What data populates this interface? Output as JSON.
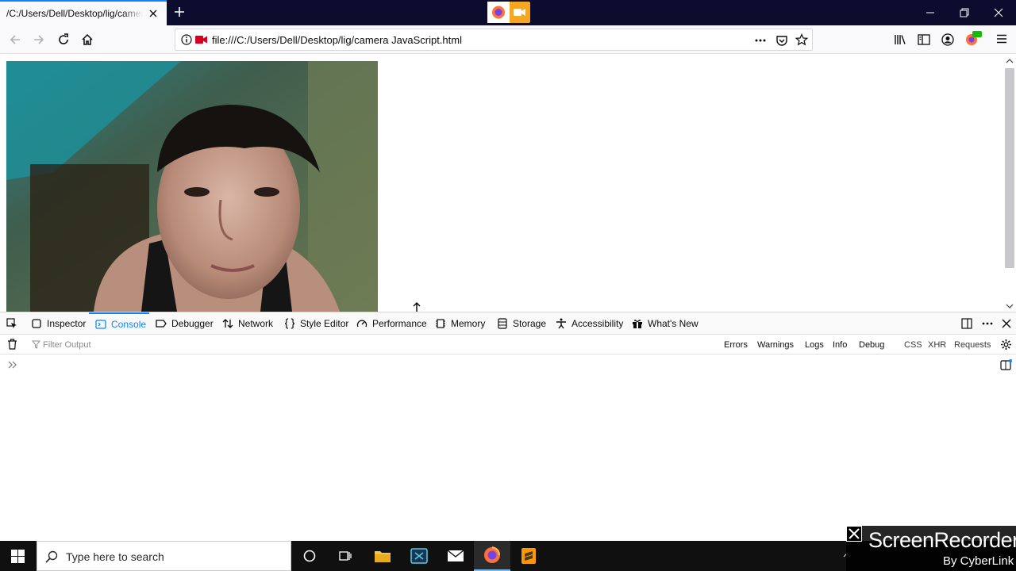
{
  "browser": {
    "tab": {
      "title": "/C:/Users/Dell/Desktop/lig/camera JavaScript.html"
    },
    "url": "file:///C:/Users/Dell/Desktop/lig/camera JavaScript.html",
    "accent": "#0a84ff"
  },
  "devtools": {
    "tabs": [
      {
        "label": "Inspector",
        "icon": "inspector-icon"
      },
      {
        "label": "Console",
        "icon": "console-icon",
        "selected": true
      },
      {
        "label": "Debugger",
        "icon": "debugger-icon"
      },
      {
        "label": "Network",
        "icon": "network-icon"
      },
      {
        "label": "Style Editor",
        "icon": "style-editor-icon"
      },
      {
        "label": "Performance",
        "icon": "performance-icon"
      },
      {
        "label": "Memory",
        "icon": "memory-icon"
      },
      {
        "label": "Storage",
        "icon": "storage-icon"
      },
      {
        "label": "Accessibility",
        "icon": "accessibility-icon"
      },
      {
        "label": "What's New",
        "icon": "gift-icon"
      }
    ],
    "filter_placeholder": "Filter Output",
    "log_filters": [
      "Errors",
      "Warnings",
      "Logs",
      "Info",
      "Debug"
    ],
    "request_filters": [
      "CSS",
      "XHR",
      "Requests"
    ]
  },
  "taskbar": {
    "search_placeholder": "Type here to search"
  },
  "watermark": {
    "title": "ScreenRecorder",
    "subtitle": "By CyberLink"
  }
}
